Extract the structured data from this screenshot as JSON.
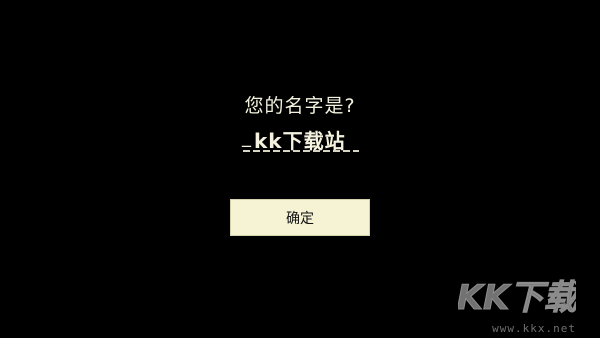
{
  "dialog": {
    "prompt": "您的名字是?",
    "name_prefix": "_",
    "name_value": "kk下载站",
    "confirm_label": "确定"
  },
  "watermark": {
    "logo_text": "KK下载",
    "url": "www.kkx.net"
  },
  "colors": {
    "background": "#000000",
    "text": "#f4f2de",
    "button_bg": "#f6f3d4",
    "button_text": "#111111"
  }
}
